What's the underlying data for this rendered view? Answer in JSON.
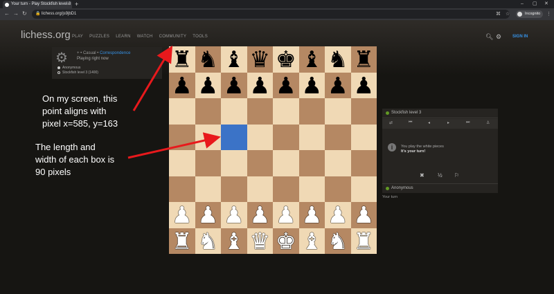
{
  "browser": {
    "tab_title": "Your turn - Play Stockfish level 3",
    "url": "lichess.org/js9jbD1",
    "incognito_label": "Incognito"
  },
  "site": {
    "logo": "lichess.org",
    "nav": [
      "PLAY",
      "PUZZLES",
      "LEARN",
      "WATCH",
      "COMMUNITY",
      "TOOLS"
    ],
    "sign_in": "SIGN IN"
  },
  "game_info": {
    "mode_prefix": "+ • Casual •",
    "mode_link": "Correspondence",
    "status": "Playing right now",
    "players": [
      "Anonymous",
      "Stockfish level 3 (1400)"
    ]
  },
  "board": {
    "highlight": "c5",
    "ranks": [
      [
        "r",
        "n",
        "b",
        "q",
        "k",
        "b",
        "n",
        "r"
      ],
      [
        "p",
        "p",
        "p",
        "p",
        "p",
        "p",
        "p",
        "p"
      ],
      [
        "",
        "",
        "",
        "",
        "",
        "",
        "",
        ""
      ],
      [
        "",
        "",
        "",
        "",
        "",
        "",
        "",
        ""
      ],
      [
        "",
        "",
        "",
        "",
        "",
        "",
        "",
        ""
      ],
      [
        "",
        "",
        "",
        "",
        "",
        "",
        "",
        ""
      ],
      [
        "P",
        "P",
        "P",
        "P",
        "P",
        "P",
        "P",
        "P"
      ],
      [
        "R",
        "N",
        "B",
        "Q",
        "K",
        "B",
        "N",
        "R"
      ]
    ],
    "colors": {
      "light": "#f0d9b5",
      "dark": "#b58863",
      "highlight": "#3b73c7"
    }
  },
  "side_panel": {
    "opponent": "Stockfish level 3",
    "message_line1": "You play the white pieces",
    "message_line2": "It's your turn!",
    "draw_label": "½",
    "player": "Anonymous",
    "your_turn": "Your turn"
  },
  "annotations": {
    "top_lines": [
      "On my screen, this",
      "point aligns with",
      "pixel x=585, y=163"
    ],
    "bottom_lines": [
      "The length and",
      "width of each box is",
      "90 pixels"
    ],
    "arrow_color": "#e8191c"
  }
}
